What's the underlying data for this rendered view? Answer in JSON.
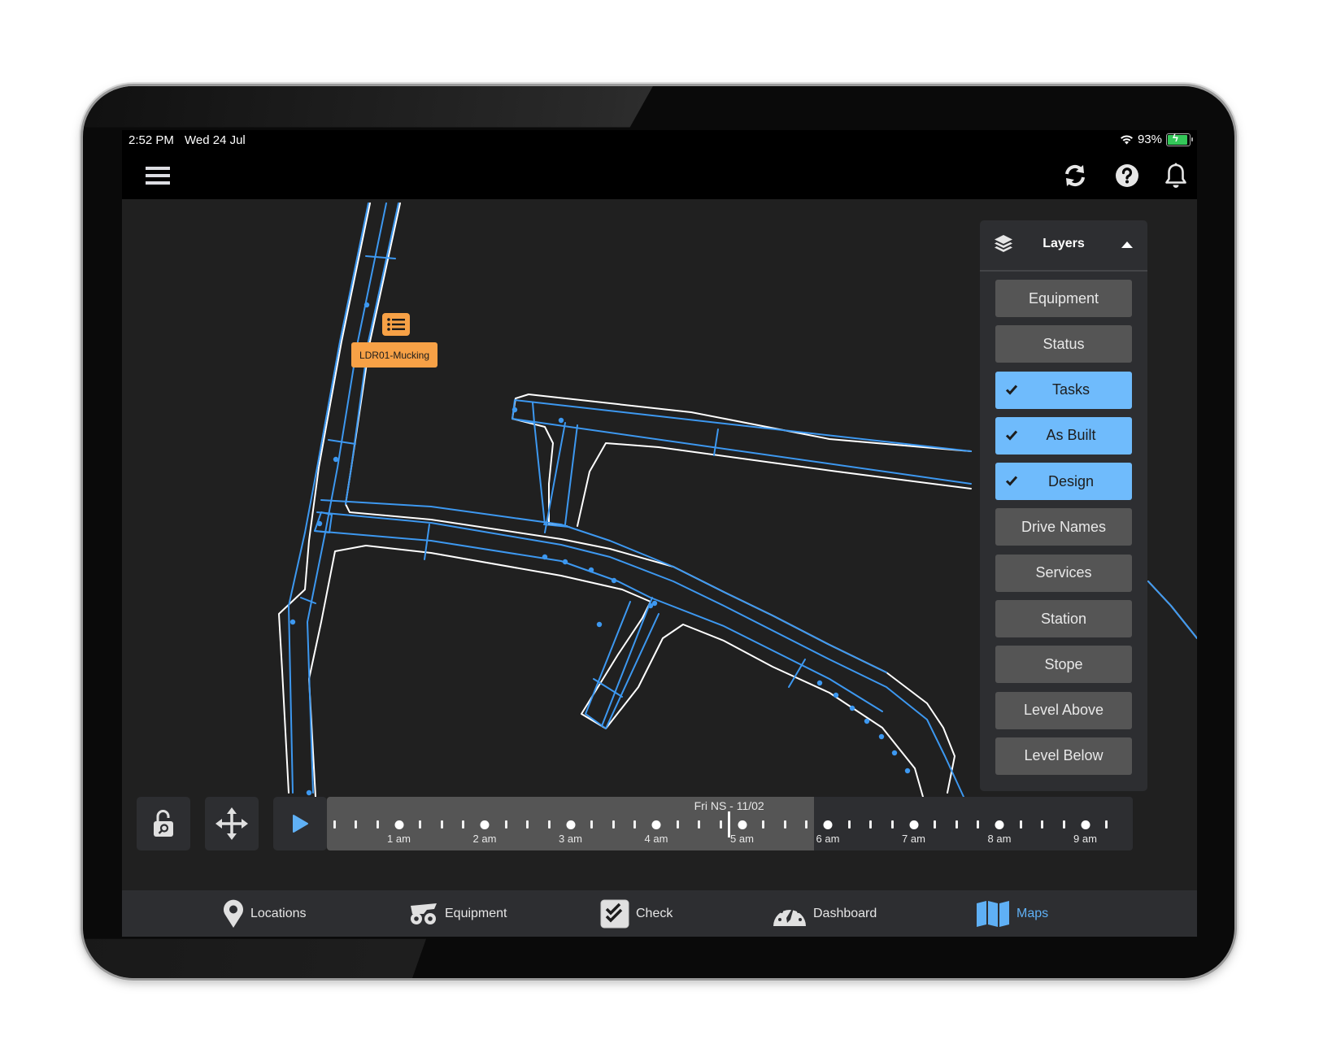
{
  "status_bar": {
    "time": "2:52 PM",
    "date": "Wed 24 Jul",
    "battery_percent": "93%",
    "battery_level": 0.93,
    "charging": true
  },
  "top_bar": {
    "menu_icon": "hamburger-menu-icon",
    "actions": [
      {
        "name": "sync",
        "icon": "sync-icon"
      },
      {
        "name": "help",
        "icon": "question-circle-icon"
      },
      {
        "name": "notifications",
        "icon": "bell-icon"
      }
    ]
  },
  "map": {
    "task_marker": {
      "icon": "list-icon",
      "label": "LDR01-Mucking",
      "color": "#f7a146"
    },
    "colors": {
      "background": "#202020",
      "design_line": "#3d98f0",
      "as_built_outline": "#ffffff"
    }
  },
  "layers_panel": {
    "title": "Layers",
    "icon": "layers-icon",
    "expanded": true,
    "items": [
      {
        "label": "Equipment",
        "active": false
      },
      {
        "label": "Status",
        "active": false
      },
      {
        "label": "Tasks",
        "active": true
      },
      {
        "label": "As Built",
        "active": true
      },
      {
        "label": "Design",
        "active": true
      },
      {
        "label": "Drive Names",
        "active": false
      },
      {
        "label": "Services",
        "active": false
      },
      {
        "label": "Station",
        "active": false
      },
      {
        "label": "Stope",
        "active": false
      },
      {
        "label": "Level Above",
        "active": false
      },
      {
        "label": "Level Below",
        "active": false
      }
    ],
    "active_color": "#6fbbfc",
    "inactive_color": "#555555"
  },
  "controls": {
    "lock_button": {
      "icon": "unlock-search-icon"
    },
    "pan_button": {
      "icon": "move-arrows-icon"
    },
    "play_button": {
      "icon": "play-icon",
      "color": "#5fb0f5"
    }
  },
  "timeline": {
    "shift_label": "Fri NS - 11/02",
    "hours": [
      "1 am",
      "2 am",
      "3 am",
      "4 am",
      "5 am",
      "6 am",
      "7 am",
      "8 am",
      "9 am"
    ],
    "current_time_position_hours": 4.85
  },
  "tab_bar": {
    "tabs": [
      {
        "label": "Locations",
        "icon": "map-pin-icon",
        "active": false
      },
      {
        "label": "Equipment",
        "icon": "haul-truck-icon",
        "active": false
      },
      {
        "label": "Check",
        "icon": "checklist-icon",
        "active": false
      },
      {
        "label": "Dashboard",
        "icon": "gauge-icon",
        "active": false
      },
      {
        "label": "Maps",
        "icon": "folded-map-icon",
        "active": true
      }
    ],
    "active_color": "#5fb0f5"
  }
}
